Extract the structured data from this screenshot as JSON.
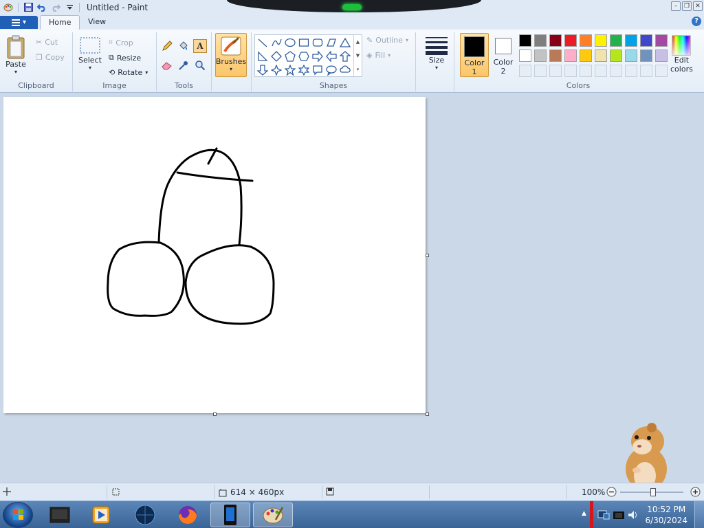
{
  "window": {
    "title": "Untitled - Paint"
  },
  "tabs": [
    {
      "label": "Home"
    },
    {
      "label": "View"
    }
  ],
  "clipboard": {
    "paste": "Paste",
    "cut": "Cut",
    "copy": "Copy",
    "group": "Clipboard"
  },
  "image": {
    "select": "Select",
    "crop": "Crop",
    "resize": "Resize",
    "rotate": "Rotate",
    "group": "Image"
  },
  "tools": {
    "group": "Tools",
    "brushes": "Brushes"
  },
  "shapes": {
    "outline": "Outline",
    "fill": "Fill",
    "group": "Shapes"
  },
  "size": {
    "label": "Size"
  },
  "colors": {
    "color1_label": "Color",
    "color1_num": "1",
    "color2_label": "Color",
    "color2_num": "2",
    "edit_label": "Edit",
    "edit_label2": "colors",
    "group": "Colors",
    "color1": "#000000",
    "color2": "#ffffff",
    "palette_row1": [
      "#000000",
      "#7f7f7f",
      "#880015",
      "#ed1c24",
      "#ff7f27",
      "#fff200",
      "#22b14c",
      "#00a2e8",
      "#3f48cc",
      "#a349a4"
    ],
    "palette_row2": [
      "#ffffff",
      "#c3c3c3",
      "#b97a57",
      "#ffaec9",
      "#ffc90e",
      "#efe4b0",
      "#b5e61d",
      "#99d9ea",
      "#7092be",
      "#c8bfe7"
    ]
  },
  "status": {
    "dimensions": "614 × 460px",
    "zoom": "100%"
  },
  "taskbar": {
    "time": "10:52 PM",
    "date": "6/30/2024"
  }
}
